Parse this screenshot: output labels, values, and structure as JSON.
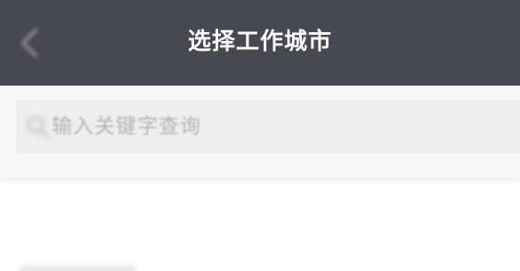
{
  "nav": {
    "title": "选择工作城市",
    "back_icon": "chevron-left-icon",
    "background": "#474950"
  },
  "search": {
    "placeholder": "输入关键字查询",
    "icon": "search-icon"
  },
  "section": {
    "title": "",
    "visibility": "blurred"
  }
}
